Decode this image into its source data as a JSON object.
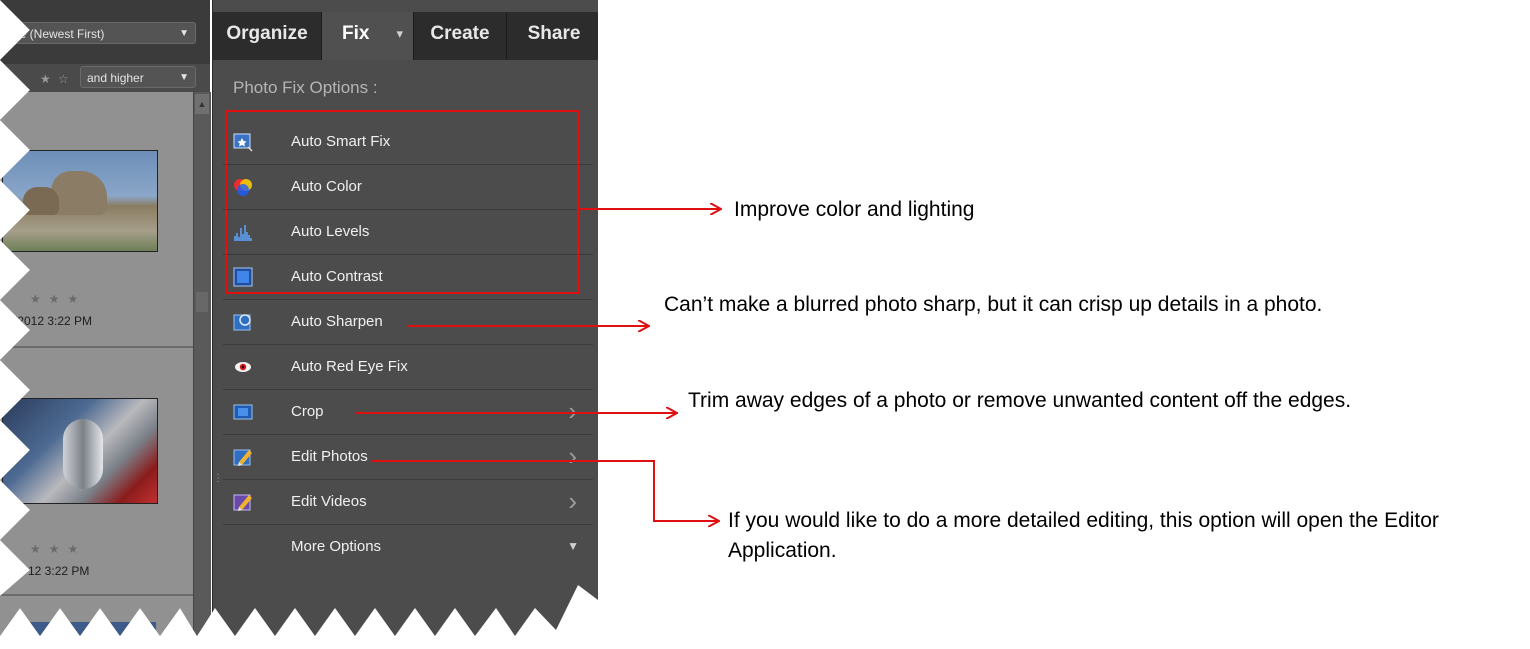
{
  "sidebar": {
    "sort_label": "Date (Newest First)",
    "rating_filter_label": "and higher",
    "items": [
      {
        "date": "/2012 3:22 PM",
        "thumb_colors": [
          "#6d8fb8",
          "#a59e8a"
        ]
      },
      {
        "date": "12 3:22 PM",
        "thumb_colors": [
          "#4d6a92",
          "#b9b9bd"
        ]
      }
    ]
  },
  "tabs": [
    {
      "label": "Organize"
    },
    {
      "label": "Fix",
      "active": true
    },
    {
      "label": "Create"
    },
    {
      "label": "Share"
    }
  ],
  "panel": {
    "title": "Photo Fix Options :",
    "options": [
      {
        "label": "Auto Smart Fix",
        "icon": "auto-smart-fix-icon"
      },
      {
        "label": "Auto Color",
        "icon": "auto-color-icon"
      },
      {
        "label": "Auto Levels",
        "icon": "auto-levels-icon"
      },
      {
        "label": "Auto Contrast",
        "icon": "auto-contrast-icon"
      },
      {
        "label": "Auto Sharpen",
        "icon": "auto-sharpen-icon"
      },
      {
        "label": "Auto Red Eye Fix",
        "icon": "red-eye-icon"
      },
      {
        "label": "Crop",
        "icon": "crop-icon"
      },
      {
        "label": "Edit Photos",
        "icon": "edit-photos-icon"
      },
      {
        "label": "Edit Videos",
        "icon": "edit-videos-icon"
      },
      {
        "label": "More Options",
        "icon": "chevron-down-icon"
      }
    ]
  },
  "annotations": {
    "improve": "Improve color and lighting",
    "sharpen": "Can’t make a blurred photo sharp, but it can crisp up       details in a photo.",
    "crop": "Trim away edges of a photo or remove unwanted content off the edges.",
    "edit": "If you would like to do a more detailed editing, this option will open the Editor Application."
  },
  "colors": {
    "highlight": "#e01010",
    "panel_bg": "#4c4c4c",
    "tab_bar": "#2c2c2c"
  }
}
